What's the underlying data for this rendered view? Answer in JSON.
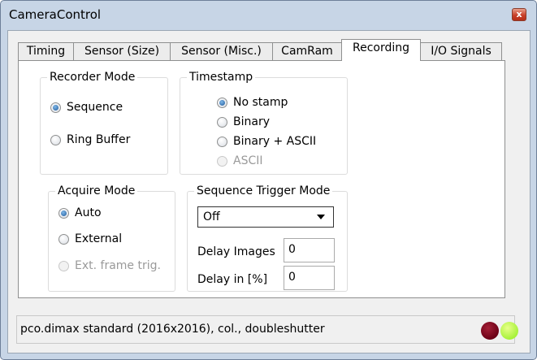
{
  "window": {
    "title": "CameraControl",
    "close_glyph": "x"
  },
  "tabs": [
    {
      "label": "Timing",
      "active": false
    },
    {
      "label": "Sensor (Size)",
      "active": false
    },
    {
      "label": "Sensor (Misc.)",
      "active": false
    },
    {
      "label": "CamRam",
      "active": false
    },
    {
      "label": "Recording",
      "active": true
    },
    {
      "label": "I/O Signals",
      "active": false
    }
  ],
  "recorder_mode": {
    "title": "Recorder Mode",
    "options": [
      {
        "label": "Sequence",
        "checked": true,
        "enabled": true
      },
      {
        "label": "Ring Buffer",
        "checked": false,
        "enabled": true
      }
    ]
  },
  "timestamp": {
    "title": "Timestamp",
    "options": [
      {
        "label": "No stamp",
        "checked": true,
        "enabled": true
      },
      {
        "label": "Binary",
        "checked": false,
        "enabled": true
      },
      {
        "label": "Binary + ASCII",
        "checked": false,
        "enabled": true
      },
      {
        "label": "ASCII",
        "checked": false,
        "enabled": false
      }
    ]
  },
  "acquire_mode": {
    "title": "Acquire Mode",
    "options": [
      {
        "label": "Auto",
        "checked": true,
        "enabled": true
      },
      {
        "label": "External",
        "checked": false,
        "enabled": true
      },
      {
        "label": "Ext. frame trig.",
        "checked": false,
        "enabled": false
      }
    ]
  },
  "sequence_trigger": {
    "title": "Sequence Trigger Mode",
    "select_value": "Off",
    "delay_images_label": "Delay Images",
    "delay_images_value": "0",
    "delay_percent_label": "Delay in [%]",
    "delay_percent_value": "0"
  },
  "status": {
    "text": "pco.dimax standard (2016x2016), col., doubleshutter",
    "led_colors": {
      "red": "#7b0a22",
      "green": "#b8f555"
    }
  }
}
